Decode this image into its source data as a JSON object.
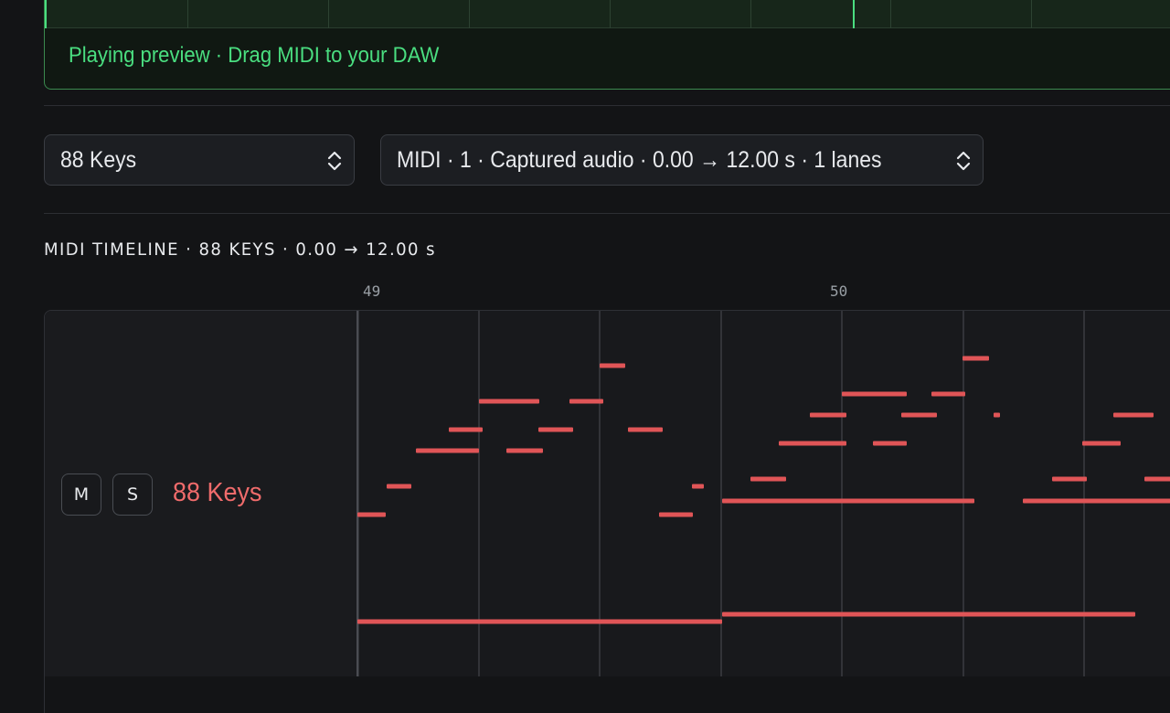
{
  "preview": {
    "status": "Playing preview · Drag MIDI to your DAW"
  },
  "instrument_select": {
    "value": "88 Keys"
  },
  "midi_select": {
    "value": "MIDI · 1 · Captured audio · 0.00 → 12.00 s · 1 lanes"
  },
  "timeline": {
    "title": "MIDI TIMELINE · 88 KEYS · 0.00 → 12.00 s",
    "ruler": [
      "49",
      "50"
    ],
    "track": {
      "mute_label": "M",
      "solo_label": "S",
      "name": "88 Keys",
      "color": "#e05557"
    }
  },
  "colors": {
    "accent_green": "#4ade80",
    "note_red": "#e05557",
    "background": "#131416"
  },
  "icons": {
    "select_chevron": "chevron-up-down-icon"
  }
}
